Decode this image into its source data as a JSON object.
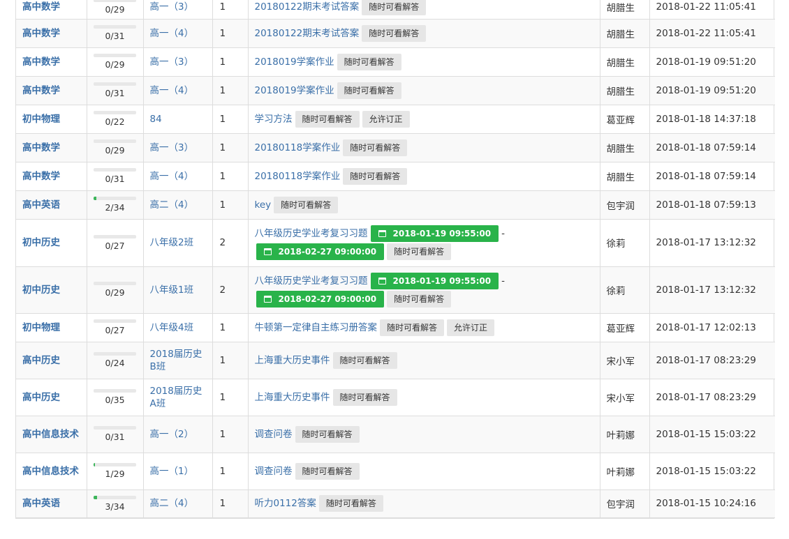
{
  "rows": [
    {
      "subject": "高中数学",
      "progress_text": "0/29",
      "progress": 0.0,
      "class": "高一（3）",
      "count": "1",
      "title": "20180122期末考试答案",
      "start": "",
      "end": "",
      "tags": [
        "随时可看解答"
      ],
      "teacher": "胡腊生",
      "time": "2018-01-22 11:05:41"
    },
    {
      "subject": "高中数学",
      "progress_text": "0/31",
      "progress": 0.0,
      "class": "高一（4）",
      "count": "1",
      "title": "20180122期末考试答案",
      "start": "",
      "end": "",
      "tags": [
        "随时可看解答"
      ],
      "teacher": "胡腊生",
      "time": "2018-01-22 11:05:41"
    },
    {
      "subject": "高中数学",
      "progress_text": "0/29",
      "progress": 0.0,
      "class": "高一（3）",
      "count": "1",
      "title": "2018019学案作业",
      "start": "",
      "end": "",
      "tags": [
        "随时可看解答"
      ],
      "teacher": "胡腊生",
      "time": "2018-01-19 09:51:20"
    },
    {
      "subject": "高中数学",
      "progress_text": "0/31",
      "progress": 0.0,
      "class": "高一（4）",
      "count": "1",
      "title": "2018019学案作业",
      "start": "",
      "end": "",
      "tags": [
        "随时可看解答"
      ],
      "teacher": "胡腊生",
      "time": "2018-01-19 09:51:20"
    },
    {
      "subject": "初中物理",
      "progress_text": "0/22",
      "progress": 0.0,
      "class": "84",
      "count": "1",
      "title": "学习方法",
      "start": "",
      "end": "",
      "tags": [
        "随时可看解答",
        "允许订正"
      ],
      "teacher": "葛亚辉",
      "time": "2018-01-18 14:37:18"
    },
    {
      "subject": "高中数学",
      "progress_text": "0/29",
      "progress": 0.0,
      "class": "高一（3）",
      "count": "1",
      "title": "20180118学案作业",
      "start": "",
      "end": "",
      "tags": [
        "随时可看解答"
      ],
      "teacher": "胡腊生",
      "time": "2018-01-18 07:59:14"
    },
    {
      "subject": "高中数学",
      "progress_text": "0/31",
      "progress": 0.0,
      "class": "高一（4）",
      "count": "1",
      "title": "20180118学案作业",
      "start": "",
      "end": "",
      "tags": [
        "随时可看解答"
      ],
      "teacher": "胡腊生",
      "time": "2018-01-18 07:59:14"
    },
    {
      "subject": "高中英语",
      "progress_text": "2/34",
      "progress": 0.059,
      "class": "高二（4）",
      "count": "1",
      "title": "key",
      "start": "",
      "end": "",
      "tags": [
        "随时可看解答"
      ],
      "teacher": "包宇润",
      "time": "2018-01-18 07:59:13"
    },
    {
      "subject": "初中历史",
      "progress_text": "0/27",
      "progress": 0.0,
      "class": "八年级2班",
      "count": "2",
      "title": "八年级历史学业考复习习题",
      "start": "2018-01-19 09:55:00",
      "end": "2018-02-27 09:00:00",
      "tags": [
        "随时可看解答"
      ],
      "teacher": "徐莉",
      "time": "2018-01-17 13:12:32"
    },
    {
      "subject": "初中历史",
      "progress_text": "0/29",
      "progress": 0.0,
      "class": "八年级1班",
      "count": "2",
      "title": "八年级历史学业考复习习题",
      "start": "2018-01-19 09:55:00",
      "end": "2018-02-27 09:00:00",
      "tags": [
        "随时可看解答"
      ],
      "teacher": "徐莉",
      "time": "2018-01-17 13:12:32"
    },
    {
      "subject": "初中物理",
      "progress_text": "0/27",
      "progress": 0.0,
      "class": "八年级4班",
      "count": "1",
      "title": "牛顿第一定律自主练习册答案",
      "start": "",
      "end": "",
      "tags": [
        "随时可看解答",
        "允许订正"
      ],
      "teacher": "葛亚辉",
      "time": "2018-01-17 12:02:13"
    },
    {
      "subject": "高中历史",
      "progress_text": "0/24",
      "progress": 0.0,
      "class": "2018届历史B班",
      "count": "1",
      "title": "上海重大历史事件",
      "start": "",
      "end": "",
      "tags": [
        "随时可看解答"
      ],
      "teacher": "宋小军",
      "time": "2018-01-17 08:23:29"
    },
    {
      "subject": "高中历史",
      "progress_text": "0/35",
      "progress": 0.0,
      "class": "2018届历史A班",
      "count": "1",
      "title": "上海重大历史事件",
      "start": "",
      "end": "",
      "tags": [
        "随时可看解答"
      ],
      "teacher": "宋小军",
      "time": "2018-01-17 08:23:29"
    },
    {
      "subject": "高中信息技术",
      "progress_text": "0/31",
      "progress": 0.0,
      "class": "高一（2）",
      "count": "1",
      "title": "调查问卷",
      "start": "",
      "end": "",
      "tags": [
        "随时可看解答"
      ],
      "teacher": "叶莉娜",
      "time": "2018-01-15 15:03:22"
    },
    {
      "subject": "高中信息技术",
      "progress_text": "1/29",
      "progress": 0.034,
      "class": "高一（1）",
      "count": "1",
      "title": "调查问卷",
      "start": "",
      "end": "",
      "tags": [
        "随时可看解答"
      ],
      "teacher": "叶莉娜",
      "time": "2018-01-15 15:03:22"
    },
    {
      "subject": "高中英语",
      "progress_text": "3/34",
      "progress": 0.088,
      "class": "高二（4）",
      "count": "1",
      "title": "听力0112答案",
      "start": "",
      "end": "",
      "tags": [
        "随时可看解答"
      ],
      "teacher": "包宇润",
      "time": "2018-01-15 10:24:16"
    }
  ],
  "date_separator": "-",
  "colors": {
    "link": "#3a6fa8",
    "progress": "#3cb55a",
    "date_badge": "#29b34a",
    "tag_bg": "#e6e6e6",
    "stripe": "#f9f9f9"
  },
  "icons": {
    "date": "calendar-icon"
  }
}
